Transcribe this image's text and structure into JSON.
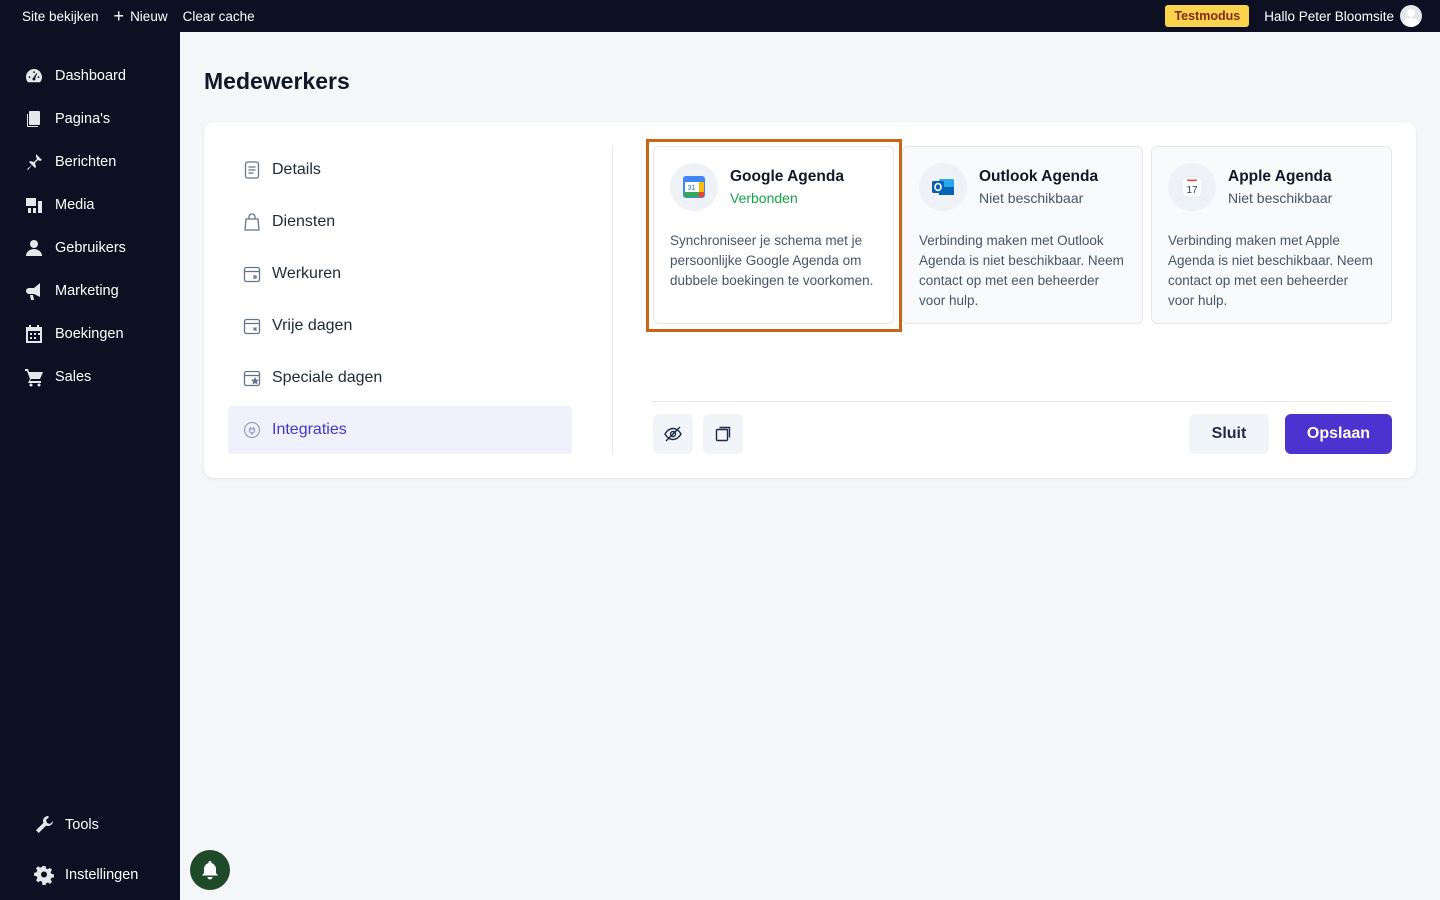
{
  "topbar": {
    "view_site": "Site bekijken",
    "new_label": "Nieuw",
    "clear_cache": "Clear cache",
    "test_mode": "Testmodus",
    "greeting": "Hallo Peter Bloomsite"
  },
  "sidebar": {
    "items": [
      {
        "label": "Dashboard",
        "icon": "dashboard-icon"
      },
      {
        "label": "Pagina's",
        "icon": "pages-icon"
      },
      {
        "label": "Berichten",
        "icon": "pin-icon"
      },
      {
        "label": "Media",
        "icon": "media-icon"
      },
      {
        "label": "Gebruikers",
        "icon": "user-icon"
      },
      {
        "label": "Marketing",
        "icon": "megaphone-icon"
      },
      {
        "label": "Boekingen",
        "icon": "calendar-icon"
      },
      {
        "label": "Sales",
        "icon": "cart-icon"
      }
    ],
    "bottom_items": [
      {
        "label": "Tools",
        "icon": "wrench-icon"
      },
      {
        "label": "Instellingen",
        "icon": "gear-icon"
      }
    ]
  },
  "page": {
    "title": "Medewerkers"
  },
  "subnav": {
    "items": [
      {
        "label": "Details",
        "icon": "document-icon"
      },
      {
        "label": "Diensten",
        "icon": "bag-icon"
      },
      {
        "label": "Werkuren",
        "icon": "calendar-clock-icon"
      },
      {
        "label": "Vrije dagen",
        "icon": "calendar-x-icon"
      },
      {
        "label": "Speciale dagen",
        "icon": "calendar-star-icon"
      },
      {
        "label": "Integraties",
        "icon": "plug-icon"
      }
    ],
    "active": "Integraties"
  },
  "integrations": [
    {
      "name": "Google Agenda",
      "status": "Verbonden",
      "description": "Synchroniseer je schema met je persoonlijke Google Agenda om dubbele boekingen te voorkomen.",
      "icon": "google-calendar-icon"
    },
    {
      "name": "Outlook Agenda",
      "status": "Niet beschikbaar",
      "description": "Verbinding maken met Outlook Agenda is niet beschikbaar. Neem contact op met een beheerder voor hulp.",
      "icon": "outlook-icon"
    },
    {
      "name": "Apple Agenda",
      "status": "Niet beschikbaar",
      "description": "Verbinding maken met Apple Agenda is niet beschikbaar. Neem contact op met een beheerder voor hulp.",
      "icon": "apple-calendar-icon"
    }
  ],
  "actions": {
    "close": "Sluit",
    "save": "Opslaan"
  },
  "colors": {
    "sidebar_bg": "#0c1022",
    "accent": "#4c33d0",
    "connected": "#16a34a",
    "highlight": "#cc6417",
    "test_badge": "#fcd34d"
  }
}
